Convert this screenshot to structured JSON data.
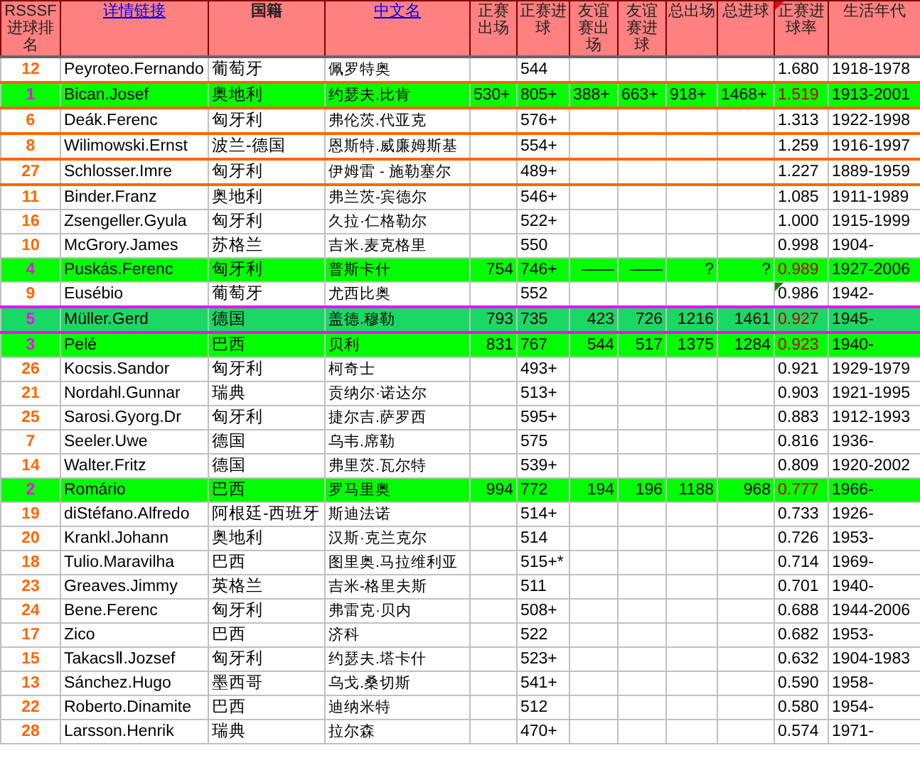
{
  "columns": [
    {
      "label": "RSSSF进球排名",
      "link": false,
      "bold": false
    },
    {
      "label": "详情链接",
      "link": true,
      "bold": false
    },
    {
      "label": "国籍",
      "link": false,
      "bold": true
    },
    {
      "label": "中文名",
      "link": true,
      "bold": false
    },
    {
      "label": "正赛出场",
      "link": false,
      "bold": false
    },
    {
      "label": "正赛进球",
      "link": false,
      "bold": false
    },
    {
      "label": "友谊赛出场",
      "link": false,
      "bold": false
    },
    {
      "label": "友谊赛进球",
      "link": false,
      "bold": false
    },
    {
      "label": "总出场",
      "link": false,
      "bold": false
    },
    {
      "label": "总进球",
      "link": false,
      "bold": false
    },
    {
      "label": "正赛进球率",
      "link": false,
      "bold": false,
      "comment": true
    },
    {
      "label": "生活年代",
      "link": false,
      "bold": false
    }
  ],
  "rows": [
    {
      "kind": "normal",
      "outlined": true,
      "cells": [
        "12",
        "Peyroteo.Fernando",
        "葡萄牙",
        "佩罗特奥",
        null,
        "544",
        null,
        null,
        null,
        null,
        "1.680",
        "1918-1978"
      ]
    },
    {
      "kind": "highlight",
      "outlined": true,
      "cells": [
        "1",
        "Bican.Josef",
        "奥地利",
        "约瑟夫.比肯",
        "530+",
        "805+",
        "388+",
        "663+",
        "918+",
        "1468+",
        "1.519",
        "1913-2001"
      ]
    },
    {
      "kind": "normal",
      "outlined": true,
      "cells": [
        "6",
        "Deák.Ferenc",
        "匈牙利",
        "弗伦茨.代亚克",
        null,
        "576+",
        null,
        null,
        null,
        null,
        "1.313",
        "1922-1998"
      ]
    },
    {
      "kind": "normal",
      "outlined": true,
      "cells": [
        "8",
        "Wilimowski.Ernst",
        "波兰-德国",
        "恩斯特.威廉姆斯基",
        null,
        "554+",
        null,
        null,
        null,
        null,
        "1.259",
        "1916-1997"
      ]
    },
    {
      "kind": "normal",
      "outlined": true,
      "cells": [
        "27",
        "Schlosser.Imre",
        "匈牙利",
        "伊姆雷 - 施勒塞尔",
        null,
        "489+",
        null,
        null,
        null,
        null,
        "1.227",
        "1889-1959"
      ]
    },
    {
      "kind": "normal",
      "outlined": false,
      "cells": [
        "11",
        "Binder.Franz",
        "奥地利",
        "弗兰茨-宾德尔",
        null,
        "546+",
        null,
        null,
        null,
        null,
        "1.085",
        "1911-1989"
      ]
    },
    {
      "kind": "normal",
      "outlined": false,
      "cells": [
        "16",
        "Zsengeller.Gyula",
        "匈牙利",
        "久拉·仁格勒尔",
        null,
        "522+",
        null,
        null,
        null,
        null,
        "1.000",
        "1915-1999"
      ]
    },
    {
      "kind": "normal",
      "outlined": false,
      "cells": [
        "10",
        "McGrory.James",
        "苏格兰",
        "吉米.麦克格里",
        null,
        "550",
        null,
        null,
        null,
        null,
        "0.998",
        "1904-"
      ]
    },
    {
      "kind": "highlight",
      "outlined": false,
      "cells": [
        "4",
        "Puskás.Ferenc",
        "匈牙利",
        "普斯卡什",
        "754",
        "746+",
        "——",
        "——",
        "?",
        "?",
        "0.989",
        "1927-2006"
      ]
    },
    {
      "kind": "normal",
      "outlined": false,
      "comment": true,
      "cells": [
        "9",
        "Eusébio",
        "葡萄牙",
        "尤西比奥",
        null,
        "552",
        null,
        null,
        null,
        null,
        "0.986",
        "1942-"
      ]
    },
    {
      "kind": "marked",
      "outlined": false,
      "cells": [
        "5",
        "Müller.Gerd",
        "德国",
        "盖德.穆勒",
        "793",
        "735",
        "423",
        "726",
        "1216",
        "1461",
        "0.927",
        "1945-"
      ]
    },
    {
      "kind": "highlight",
      "outlined": false,
      "cells": [
        "3",
        "Pelé",
        "巴西",
        "贝利",
        "831",
        "767",
        "544",
        "517",
        "1375",
        "1284",
        "0.923",
        "1940-"
      ]
    },
    {
      "kind": "normal",
      "outlined": false,
      "cells": [
        "26",
        "Kocsis.Sandor",
        "匈牙利",
        "柯奇士",
        null,
        "493+",
        null,
        null,
        null,
        null,
        "0.921",
        "1929-1979"
      ]
    },
    {
      "kind": "normal",
      "outlined": false,
      "cells": [
        "21",
        "Nordahl.Gunnar",
        "瑞典",
        "贡纳尔·诺达尔",
        null,
        "513+",
        null,
        null,
        null,
        null,
        "0.903",
        "1921-1995"
      ]
    },
    {
      "kind": "normal",
      "outlined": false,
      "cells": [
        "25",
        "Sarosi.Gyorg.Dr",
        "匈牙利",
        "捷尔吉.萨罗西",
        null,
        "595+",
        null,
        null,
        null,
        null,
        "0.883",
        "1912-1993"
      ]
    },
    {
      "kind": "normal",
      "outlined": false,
      "cells": [
        "7",
        "Seeler.Uwe",
        "德国",
        "乌韦.席勒",
        null,
        "575",
        null,
        null,
        null,
        null,
        "0.816",
        "1936-"
      ]
    },
    {
      "kind": "normal",
      "outlined": false,
      "cells": [
        "14",
        "Walter.Fritz",
        "德国",
        "弗里茨.瓦尔特",
        null,
        "539+",
        null,
        null,
        null,
        null,
        "0.809",
        "1920-2002"
      ]
    },
    {
      "kind": "highlight",
      "outlined": false,
      "cells": [
        "2",
        "Romário",
        "巴西",
        "罗马里奥",
        "994",
        "772",
        "194",
        "196",
        "1188",
        "968",
        "0.777",
        "1966-"
      ]
    },
    {
      "kind": "normal",
      "outlined": false,
      "cells": [
        "19",
        "diStéfano.Alfredo",
        "阿根廷-西班牙",
        "斯迪法诺",
        null,
        "514+",
        null,
        null,
        null,
        null,
        "0.733",
        "1926-"
      ]
    },
    {
      "kind": "normal",
      "outlined": false,
      "cells": [
        "20",
        "Krankl.Johann",
        "奥地利",
        "汉斯·克兰克尔",
        null,
        "514",
        null,
        null,
        null,
        null,
        "0.726",
        "1953-"
      ]
    },
    {
      "kind": "normal",
      "outlined": false,
      "cells": [
        "18",
        "Tulio.Maravilha",
        "巴西",
        "图里奥.马拉维利亚",
        null,
        "515+*",
        null,
        null,
        null,
        null,
        "0.714",
        "1969-"
      ]
    },
    {
      "kind": "normal",
      "outlined": false,
      "cells": [
        "23",
        "Greaves.Jimmy",
        "英格兰",
        "吉米-格里夫斯",
        null,
        "511",
        null,
        null,
        null,
        null,
        "0.701",
        "1940-"
      ]
    },
    {
      "kind": "normal",
      "outlined": false,
      "cells": [
        "24",
        "Bene.Ferenc",
        "匈牙利",
        "弗雷克·贝内",
        null,
        "508+",
        null,
        null,
        null,
        null,
        "0.688",
        "1944-2006"
      ]
    },
    {
      "kind": "normal",
      "outlined": false,
      "cells": [
        "17",
        "Zico",
        "巴西",
        "济科",
        null,
        "522",
        null,
        null,
        null,
        null,
        "0.682",
        "1953-"
      ]
    },
    {
      "kind": "normal",
      "outlined": false,
      "cells": [
        "15",
        "TakacsⅡ.Jozsef",
        "匈牙利",
        "约瑟夫.塔卡什",
        null,
        "523+",
        null,
        null,
        null,
        null,
        "0.632",
        "1904-1983"
      ]
    },
    {
      "kind": "normal",
      "outlined": false,
      "cells": [
        "13",
        "Sánchez.Hugo",
        "墨西哥",
        "乌戈.桑切斯",
        null,
        "541+",
        null,
        null,
        null,
        null,
        "0.590",
        "1958-"
      ]
    },
    {
      "kind": "normal",
      "outlined": false,
      "cells": [
        "22",
        "Roberto.Dinamite",
        "巴西",
        "迪纳米特",
        null,
        "512",
        null,
        null,
        null,
        null,
        "0.580",
        "1954-"
      ]
    },
    {
      "kind": "normal",
      "outlined": false,
      "cells": [
        "28",
        "Larsson.Henrik",
        "瑞典",
        "拉尔森",
        null,
        "470+",
        null,
        null,
        null,
        null,
        "0.574",
        "1971-"
      ]
    }
  ]
}
